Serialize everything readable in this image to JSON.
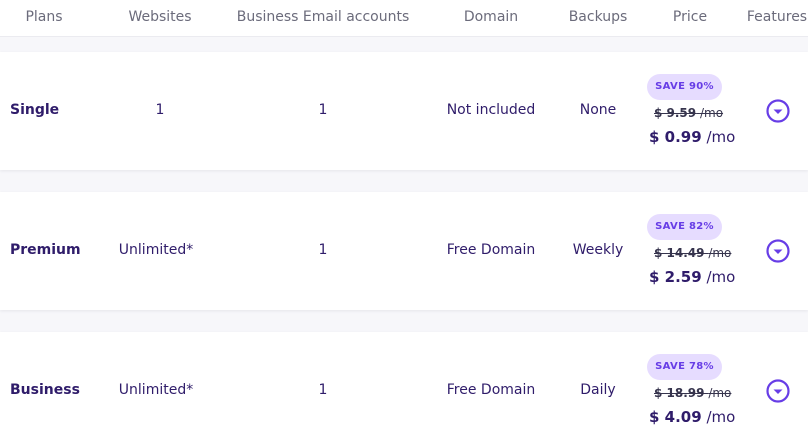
{
  "columns": {
    "plans": "Plans",
    "websites": "Websites",
    "email": "Business Email accounts",
    "domain": "Domain",
    "backups": "Backups",
    "price": "Price",
    "features": "Features"
  },
  "plans": [
    {
      "name": "Single",
      "websites": "1",
      "email_accounts": "1",
      "domain": "Not included",
      "backups": "None",
      "discount": "SAVE 90%",
      "old_price": "$ 9.59",
      "new_price": "$ 0.99",
      "per": "/mo"
    },
    {
      "name": "Premium",
      "websites": "Unlimited*",
      "email_accounts": "1",
      "domain": "Free Domain",
      "backups": "Weekly",
      "discount": "SAVE 82%",
      "old_price": "$ 14.49",
      "new_price": "$ 2.59",
      "per": "/mo"
    },
    {
      "name": "Business",
      "websites": "Unlimited*",
      "email_accounts": "1",
      "domain": "Free Domain",
      "backups": "Daily",
      "discount": "SAVE 78%",
      "old_price": "$ 18.99",
      "new_price": "$ 4.09",
      "per": "/mo"
    }
  ],
  "icons": {
    "expand": "chevron-down-circle-icon"
  },
  "colors": {
    "accent": "#673de6",
    "badge_bg": "#e6dcff",
    "text": "#2f1c6a",
    "header_text": "#6b6b7b"
  }
}
